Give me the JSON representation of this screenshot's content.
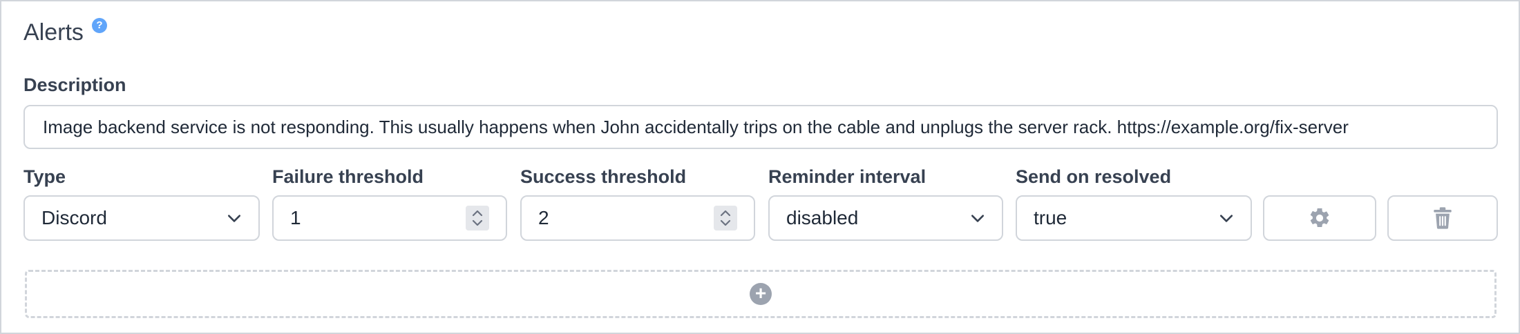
{
  "section": {
    "title": "Alerts",
    "help_icon": "question-circle-icon"
  },
  "description": {
    "label": "Description",
    "value": "Image backend service is not responding. This usually happens when John accidentally trips on the cable and unplugs the server rack. https://example.org/fix-server"
  },
  "alert": {
    "type": {
      "label": "Type",
      "value": "Discord"
    },
    "failure_threshold": {
      "label": "Failure threshold",
      "value": "1"
    },
    "success_threshold": {
      "label": "Success threshold",
      "value": "2"
    },
    "reminder_interval": {
      "label": "Reminder interval",
      "value": "disabled"
    },
    "send_on_resolved": {
      "label": "Send on resolved",
      "value": "true"
    },
    "settings_icon": "gear-icon",
    "delete_icon": "trash-icon"
  },
  "add_alert": {
    "icon": "plus-circle-icon"
  },
  "colors": {
    "help": "#60a5fa",
    "border": "#d1d5db",
    "icon": "#9ca3af"
  }
}
